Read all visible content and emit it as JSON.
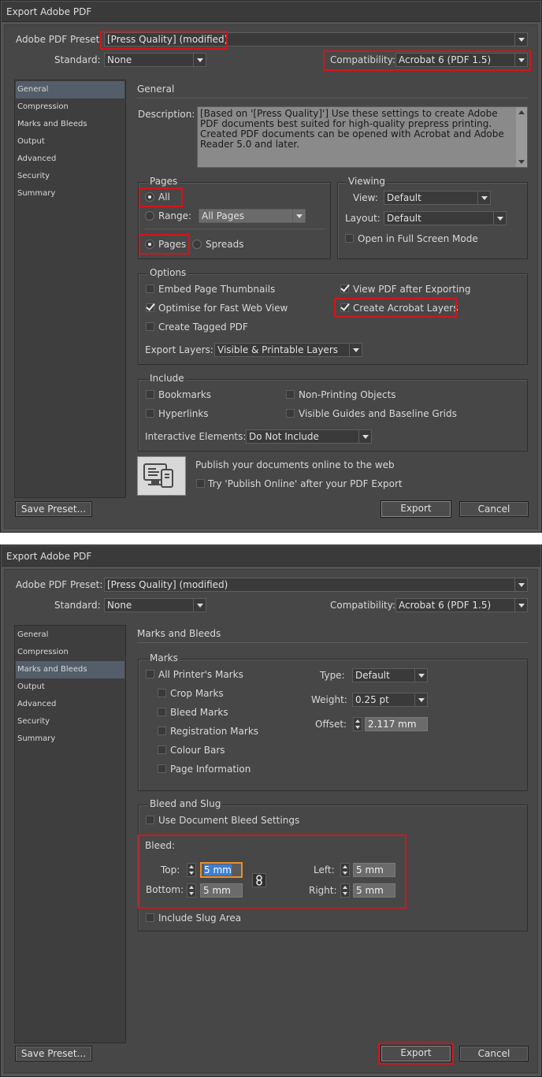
{
  "dialog_title": "Export Adobe PDF",
  "preset_label": "Adobe PDF Preset:",
  "preset_value": "[Press Quality] (modified)",
  "standard_label": "Standard:",
  "standard_value": "None",
  "compatibility_label": "Compatibility:",
  "compatibility_value": "Acrobat 6 (PDF 1.5)",
  "sidebar": [
    "General",
    "Compression",
    "Marks and Bleeds",
    "Output",
    "Advanced",
    "Security",
    "Summary"
  ],
  "buttons": {
    "save_preset": "Save Preset...",
    "export": "Export",
    "cancel": "Cancel"
  },
  "general": {
    "heading": "General",
    "description_label": "Description:",
    "description_text": "[Based on '[Press Quality]'] Use these settings to create Adobe PDF documents best suited for high-quality prepress printing.  Created PDF documents can be opened with Acrobat and Adobe Reader 5.0 and later.",
    "pages": {
      "title": "Pages",
      "all": "All",
      "range": "Range:",
      "range_value": "All Pages",
      "pages": "Pages",
      "spreads": "Spreads"
    },
    "viewing": {
      "title": "Viewing",
      "view_label": "View:",
      "view_value": "Default",
      "layout_label": "Layout:",
      "layout_value": "Default",
      "fullscreen": "Open in Full Screen Mode"
    },
    "options": {
      "title": "Options",
      "embed_thumbnails": "Embed Page Thumbnails",
      "optimise": "Optimise for Fast Web View",
      "tagged": "Create Tagged PDF",
      "view_after": "View PDF after Exporting",
      "acrobat_layers": "Create Acrobat Layers",
      "export_layers_label": "Export Layers:",
      "export_layers_value": "Visible & Printable Layers"
    },
    "include": {
      "title": "Include",
      "bookmarks": "Bookmarks",
      "hyperlinks": "Hyperlinks",
      "non_printing": "Non-Printing Objects",
      "guides": "Visible Guides and Baseline Grids",
      "interactive_label": "Interactive Elements:",
      "interactive_value": "Do Not Include"
    },
    "publish": {
      "text": "Publish your documents online to the web",
      "try": "Try 'Publish Online' after your PDF Export"
    }
  },
  "marks": {
    "heading": "Marks and Bleeds",
    "marks_group": {
      "title": "Marks",
      "all_printers": "All Printer's Marks",
      "crop": "Crop Marks",
      "bleed": "Bleed Marks",
      "registration": "Registration Marks",
      "colour_bars": "Colour Bars",
      "page_info": "Page Information",
      "type_label": "Type:",
      "type_value": "Default",
      "weight_label": "Weight:",
      "weight_value": "0.25 pt",
      "offset_label": "Offset:",
      "offset_value": "2.117 mm"
    },
    "bleed_group": {
      "title": "Bleed and Slug",
      "use_doc": "Use Document Bleed Settings",
      "bleed_label": "Bleed:",
      "top_label": "Top:",
      "top_value": "5 mm",
      "bottom_label": "Bottom:",
      "bottom_value": "5 mm",
      "left_label": "Left:",
      "left_value": "5 mm",
      "right_label": "Right:",
      "right_value": "5 mm",
      "slug": "Include Slug Area"
    }
  }
}
